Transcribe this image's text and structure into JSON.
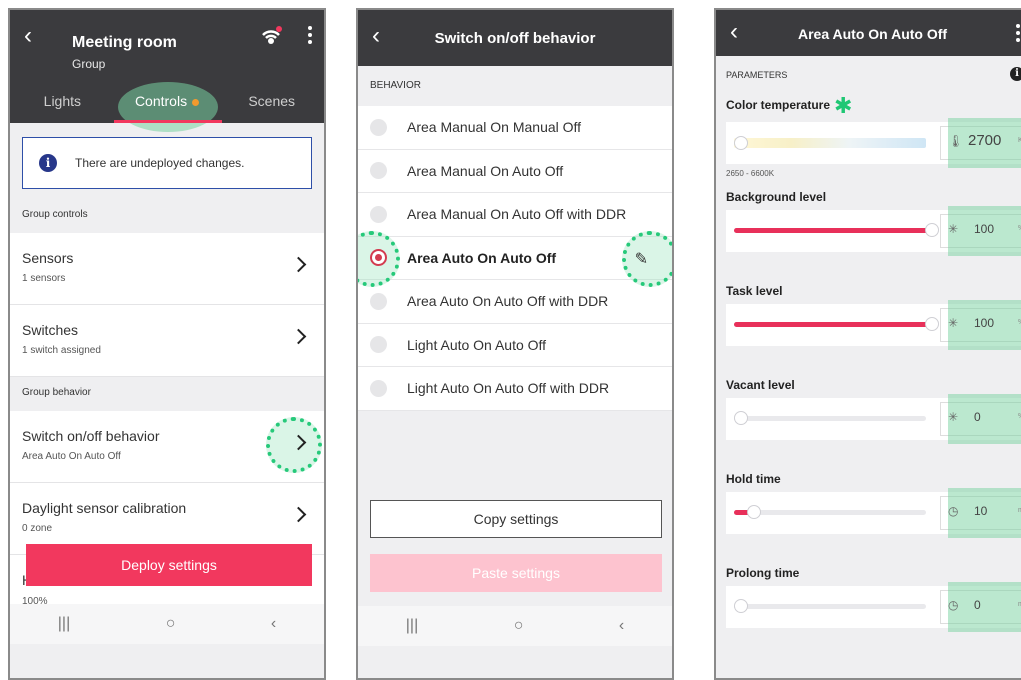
{
  "panel1": {
    "title": "Meeting room",
    "subtitle": "Group",
    "tabs": [
      {
        "label": "Lights"
      },
      {
        "label": "Controls"
      },
      {
        "label": "Scenes"
      }
    ],
    "notice": "There are undeployed changes.",
    "group_controls_label": "Group controls",
    "rows": [
      {
        "title": "Sensors",
        "sub": "1 sensors"
      },
      {
        "title": "Switches",
        "sub": "1 switch assigned"
      }
    ],
    "group_behavior_label": "Group behavior",
    "behavior_rows": [
      {
        "title": "Switch on/off behavior",
        "sub": "Area Auto On Auto Off"
      },
      {
        "title": "Daylight sensor calibration",
        "sub": "0 zone"
      }
    ],
    "hidden_row_first_letter": "H",
    "hidden_row_sub": "100%",
    "deploy_label": "Deploy settings",
    "nav": {
      "recent": "|||",
      "home": "○",
      "back": "‹"
    }
  },
  "panel2": {
    "title": "Switch on/off behavior",
    "section": "BEHAVIOR",
    "options": [
      "Area Manual On Manual Off",
      "Area Manual On Auto Off",
      "Area Manual On Auto Off with DDR",
      "Area Auto On Auto Off",
      "Area Auto On Auto Off with DDR",
      "Light Auto On Auto Off",
      "Light Auto On Auto Off with DDR"
    ],
    "selected_option": "Area Auto On Auto Off",
    "copy_label": "Copy settings",
    "paste_label": "Paste settings",
    "nav": {
      "recent": "|||",
      "home": "○",
      "back": "‹"
    }
  },
  "panel3": {
    "title": "Area Auto On Auto Off",
    "section": "PARAMETERS",
    "color_temperature": {
      "label": "Color temperature",
      "value": "2700",
      "unit": "K",
      "range": "2650 - 6600K",
      "fraction": 0.0
    },
    "params": [
      {
        "label": "Background level",
        "value": "100",
        "unit": "%",
        "icon": "brightness-icon",
        "fraction": 1.0
      },
      {
        "label": "Task level",
        "value": "100",
        "unit": "%",
        "icon": "brightness-icon",
        "fraction": 1.0
      },
      {
        "label": "Vacant level",
        "value": "0",
        "unit": "%",
        "icon": "brightness-icon",
        "fraction": 0.0
      },
      {
        "label": "Hold time",
        "value": "10",
        "unit": "min",
        "icon": "clock-icon",
        "fraction": 0.1
      },
      {
        "label": "Prolong time",
        "value": "0",
        "unit": "min",
        "icon": "clock-icon",
        "fraction": 0.0
      }
    ]
  },
  "colors": {
    "accent": "#f2385e",
    "topbar": "#3b3b3e",
    "highlight": "#26c97a",
    "info": "#27378a"
  }
}
